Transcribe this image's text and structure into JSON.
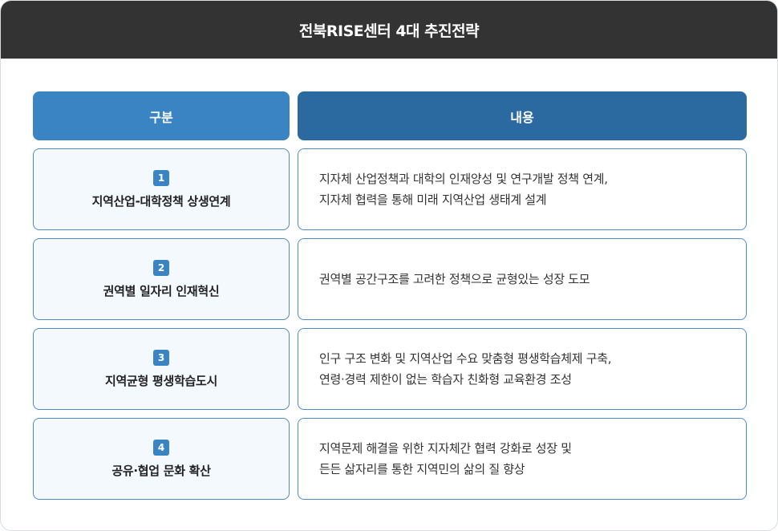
{
  "title": "전북RISE센터 4대 추진전략",
  "header": {
    "category": "구분",
    "content": "내용"
  },
  "rows": [
    {
      "num": "1",
      "name": "지역산업-대학정책 상생연계",
      "lines": [
        "지자체 산업정책과 대학의 인재양성 및 연구개발 정책 연계,",
        "지자체 협력을 통해 미래 지역산업 생태계 설계"
      ]
    },
    {
      "num": "2",
      "name": "권역별 일자리 인재혁신",
      "lines": [
        "권역별 공간구조를 고려한 정책으로 균형있는 성장 도모"
      ]
    },
    {
      "num": "3",
      "name": "지역균형 평생학습도시",
      "lines": [
        "인구 구조 변화 및 지역산업 수요 맞춤형 평생학습체제 구축,",
        "연령·경력 제한이 없는 학습자 친화형 교육환경 조성"
      ]
    },
    {
      "num": "4",
      "name": "공유·협업 문화 확산",
      "lines": [
        "지역문제 해결을 위한 지자체간 협력 강화로 성장 및",
        "든든 삶자리를 통한 지역민의 삶의 질 향상"
      ]
    }
  ]
}
